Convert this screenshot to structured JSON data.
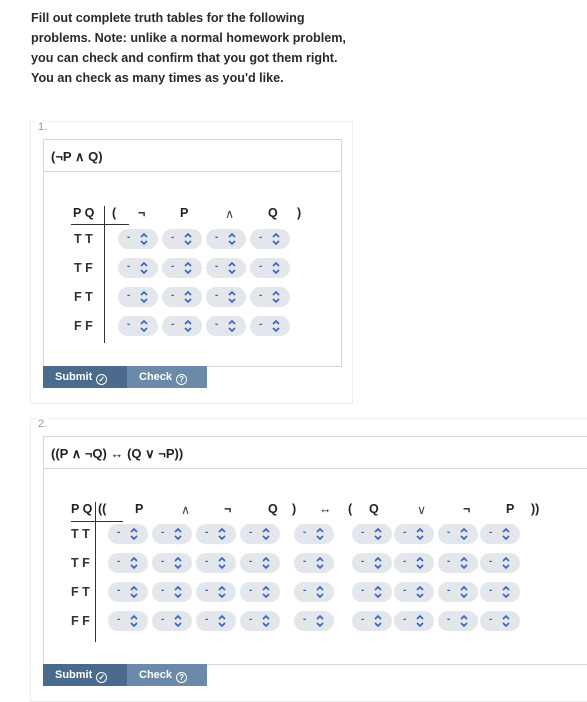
{
  "intro": "Fill out complete truth tables for the following problems. Note: unlike a normal homework problem, you can check and confirm that you got them right. You an check as many times as you'd like.",
  "select_default": "-",
  "problems": [
    {
      "number": "1.",
      "formula": "(¬P ∧ Q)",
      "var_header": "P Q",
      "header_symbols": [
        "(",
        "¬",
        "P",
        "∧",
        "Q",
        ")"
      ],
      "rows": [
        "T T",
        "T F",
        "F T",
        "F F"
      ],
      "submit_label": "Submit",
      "check_label": "Check"
    },
    {
      "number": "2.",
      "formula": "((P ∧ ¬Q) ↔ (Q ∨ ¬P))",
      "var_header": "P Q",
      "header_symbols": [
        "((",
        "P",
        "∧",
        "¬",
        "Q",
        ")",
        "↔",
        "(",
        "Q",
        "∨",
        "¬",
        "P",
        "))"
      ],
      "rows": [
        "T T",
        "T F",
        "F T",
        "F F"
      ],
      "submit_label": "Submit",
      "check_label": "Check"
    }
  ]
}
